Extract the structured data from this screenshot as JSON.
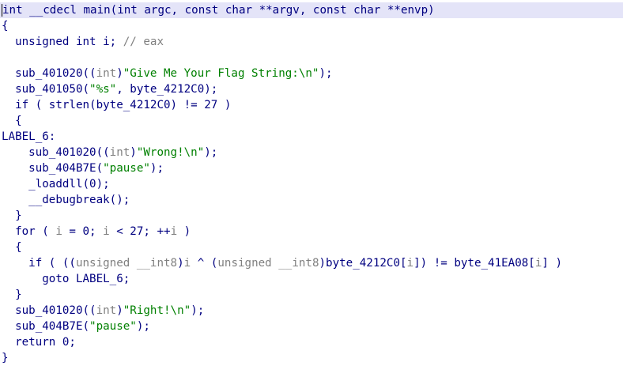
{
  "window": {
    "type": "decompiler pseudocode view"
  },
  "colors": {
    "code": "#000080",
    "comment": "#808080",
    "string": "#008000",
    "current_line_bg": "#e4e4f8"
  },
  "lines": [
    [
      {
        "t": "int __cdecl main(int argc, const char **argv, const char **envp)",
        "c": "k"
      }
    ],
    [
      {
        "t": "{",
        "c": "k"
      }
    ],
    [
      {
        "t": "  unsigned int i; ",
        "c": "k"
      },
      {
        "t": "// eax",
        "c": "c"
      }
    ],
    [
      {
        "t": "",
        "c": "k"
      }
    ],
    [
      {
        "t": "  sub_401020((",
        "c": "k"
      },
      {
        "t": "int",
        "c": "c"
      },
      {
        "t": ")",
        "c": "k"
      },
      {
        "t": "\"Give Me Your Flag String:\\n\"",
        "c": "s"
      },
      {
        "t": ");",
        "c": "k"
      }
    ],
    [
      {
        "t": "  sub_401050(",
        "c": "k"
      },
      {
        "t": "\"%s\"",
        "c": "s"
      },
      {
        "t": ", byte_4212C0);",
        "c": "k"
      }
    ],
    [
      {
        "t": "  if ( strlen(byte_4212C0) != 27 )",
        "c": "k"
      }
    ],
    [
      {
        "t": "  {",
        "c": "k"
      }
    ],
    [
      {
        "t": "LABEL_6:",
        "c": "k"
      }
    ],
    [
      {
        "t": "    sub_401020((",
        "c": "k"
      },
      {
        "t": "int",
        "c": "c"
      },
      {
        "t": ")",
        "c": "k"
      },
      {
        "t": "\"Wrong!\\n\"",
        "c": "s"
      },
      {
        "t": ");",
        "c": "k"
      }
    ],
    [
      {
        "t": "    sub_404B7E(",
        "c": "k"
      },
      {
        "t": "\"pause\"",
        "c": "s"
      },
      {
        "t": ");",
        "c": "k"
      }
    ],
    [
      {
        "t": "    _loaddll(0);",
        "c": "k"
      }
    ],
    [
      {
        "t": "    __debugbreak();",
        "c": "k"
      }
    ],
    [
      {
        "t": "  }",
        "c": "k"
      }
    ],
    [
      {
        "t": "  for ( ",
        "c": "k"
      },
      {
        "t": "i",
        "c": "c"
      },
      {
        "t": " = 0; ",
        "c": "k"
      },
      {
        "t": "i",
        "c": "c"
      },
      {
        "t": " < 27; ++",
        "c": "k"
      },
      {
        "t": "i",
        "c": "c"
      },
      {
        "t": " )",
        "c": "k"
      }
    ],
    [
      {
        "t": "  {",
        "c": "k"
      }
    ],
    [
      {
        "t": "    if ( ((",
        "c": "k"
      },
      {
        "t": "unsigned __int8",
        "c": "c"
      },
      {
        "t": ")",
        "c": "k"
      },
      {
        "t": "i",
        "c": "c"
      },
      {
        "t": " ^ (",
        "c": "k"
      },
      {
        "t": "unsigned __int8",
        "c": "c"
      },
      {
        "t": ")byte_4212C0[",
        "c": "k"
      },
      {
        "t": "i",
        "c": "c"
      },
      {
        "t": "]) != byte_41EA08[",
        "c": "k"
      },
      {
        "t": "i",
        "c": "c"
      },
      {
        "t": "] )",
        "c": "k"
      }
    ],
    [
      {
        "t": "      goto LABEL_6;",
        "c": "k"
      }
    ],
    [
      {
        "t": "  }",
        "c": "k"
      }
    ],
    [
      {
        "t": "  sub_401020((",
        "c": "k"
      },
      {
        "t": "int",
        "c": "c"
      },
      {
        "t": ")",
        "c": "k"
      },
      {
        "t": "\"Right!\\n\"",
        "c": "s"
      },
      {
        "t": ");",
        "c": "k"
      }
    ],
    [
      {
        "t": "  sub_404B7E(",
        "c": "k"
      },
      {
        "t": "\"pause\"",
        "c": "s"
      },
      {
        "t": ");",
        "c": "k"
      }
    ],
    [
      {
        "t": "  return 0;",
        "c": "k"
      }
    ],
    [
      {
        "t": "}",
        "c": "k"
      }
    ]
  ]
}
